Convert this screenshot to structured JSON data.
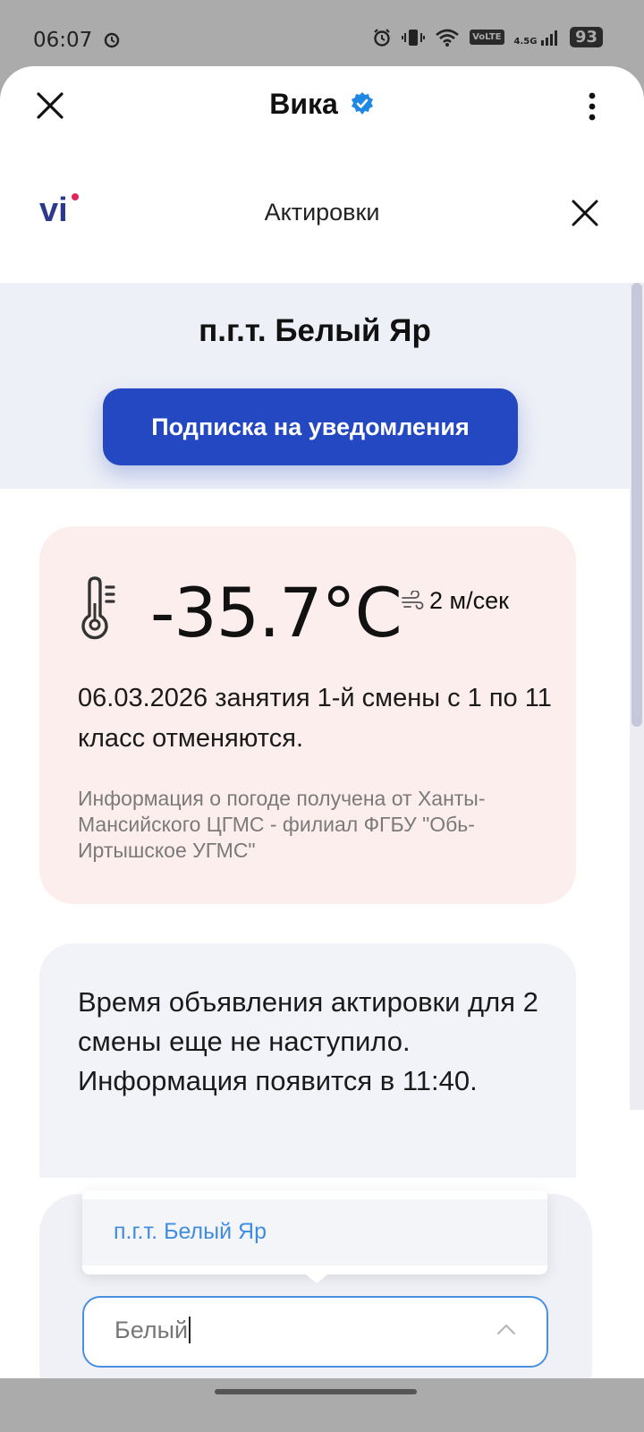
{
  "status_bar": {
    "time": "06:07",
    "network": "VoLTE",
    "signal": "4.5G",
    "battery": "93",
    "icons": [
      "alarm-icon",
      "alarm-icon",
      "vibrate-icon",
      "wifi-icon",
      "signal-icon",
      "battery-icon"
    ]
  },
  "top_bar": {
    "title": "Вика",
    "verified_color": "#1f88e5",
    "icons": [
      "close-icon",
      "verified-badge-icon",
      "more-vert-icon"
    ]
  },
  "app_header": {
    "logo_text": "vi",
    "title": "Актировки",
    "logo_colors": [
      "#2b3a8c",
      "#e2245a"
    ]
  },
  "city": {
    "name": "п.г.т. Белый Яр",
    "subscribe_label": "Подписка на уведомления",
    "button_color": "#2448c2"
  },
  "weather": {
    "temperature": "-35.7°C",
    "wind": "2 м/сек",
    "message": "06.03.2026 занятия 1-й смены с 1 по 11 класс отменяются.",
    "source": "Информация о погоде получена от Ханты-Мансийского ЦГМС - филиал ФГБУ \"Обь-Иртышское УГМС\"",
    "icons": [
      "thermometer-icon",
      "wind-icon"
    ]
  },
  "notice": {
    "text": "Время объявления актировки для 2 смены еще не наступило. Информация появится в 11:40."
  },
  "selector": {
    "options": [
      "п.г.т. Белый Яр"
    ],
    "input_value": "Белый",
    "accent_color": "#4a90e2",
    "icons": [
      "chevron-up-icon"
    ]
  }
}
